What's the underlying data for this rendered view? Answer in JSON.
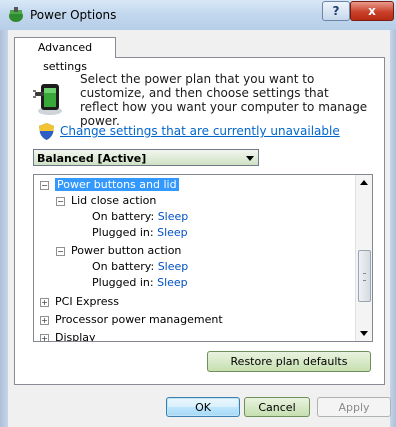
{
  "window": {
    "title": "Power Options",
    "help_label": "?",
    "close_label": "x"
  },
  "tab": {
    "label": "Advanced settings"
  },
  "intro": {
    "text": "Select the power plan that you want to customize, and then choose settings that reflect how you want your computer to manage power."
  },
  "change_link": "Change settings that are currently unavailable",
  "plan_select": {
    "selected": "Balanced [Active]"
  },
  "tree": {
    "power_buttons": "Power buttons and lid",
    "lid_close": {
      "label": "Lid close action",
      "on_battery_label": "On battery:",
      "on_battery_value": "Sleep",
      "plugged_in_label": "Plugged in:",
      "plugged_in_value": "Sleep"
    },
    "power_button": {
      "label": "Power button action",
      "on_battery_label": "On battery:",
      "on_battery_value": "Sleep",
      "plugged_in_label": "Plugged in:",
      "plugged_in_value": "Sleep"
    },
    "pci_express": "PCI Express",
    "processor": "Processor power management",
    "display": "Display",
    "expand_symbol": "+",
    "collapse_symbol": "−"
  },
  "buttons": {
    "restore": "Restore plan defaults",
    "ok": "OK",
    "cancel": "Cancel",
    "apply": "Apply"
  },
  "colors": {
    "selection": "#3399ff",
    "link": "#0066cc",
    "value": "#0050c0"
  },
  "icons": {
    "app": "power-options-icon",
    "plan": "power-plan-icon",
    "shield": "uac-shield-icon"
  }
}
